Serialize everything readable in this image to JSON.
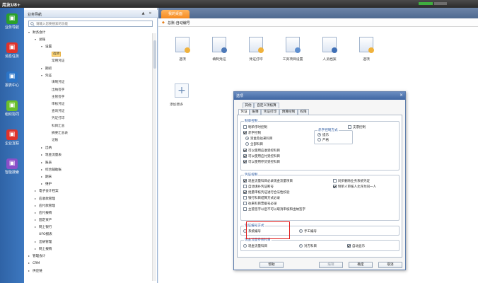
{
  "app": {
    "title": "用友U8+"
  },
  "rail": {
    "items": [
      {
        "label": "业务导航",
        "icon": "grid-icon",
        "color": "#2aa12a"
      },
      {
        "label": "消息任务",
        "icon": "message-icon",
        "color": "#e0332b"
      },
      {
        "label": "报表中心",
        "icon": "report-icon",
        "color": "#2b74c7"
      },
      {
        "label": "组织协同",
        "icon": "collaboration-icon",
        "color": "#6bbf2a"
      },
      {
        "label": "企业互联",
        "icon": "network-icon",
        "color": "#e0332b"
      },
      {
        "label": "智能搜索",
        "icon": "search-icon",
        "color": "#8a4fc9"
      }
    ]
  },
  "nav": {
    "title": "业务导航",
    "search_placeholder": "请输入您要搜索的功能",
    "tree": [
      {
        "label": "财务会计",
        "level": 0,
        "toggle": "▾"
      },
      {
        "label": "总账",
        "level": 1,
        "toggle": "▾"
      },
      {
        "label": "设置",
        "level": 2,
        "toggle": "▾"
      },
      {
        "label": "选项",
        "level": 3,
        "toggle": "",
        "selected": true
      },
      {
        "label": "常用凭证",
        "level": 3,
        "toggle": ""
      },
      {
        "label": "期初",
        "level": 2,
        "toggle": "▸"
      },
      {
        "label": "凭证",
        "level": 2,
        "toggle": "▾"
      },
      {
        "label": "填制凭证",
        "level": 3,
        "toggle": ""
      },
      {
        "label": "出纳签字",
        "level": 3,
        "toggle": ""
      },
      {
        "label": "主管签字",
        "level": 3,
        "toggle": ""
      },
      {
        "label": "审核凭证",
        "level": 3,
        "toggle": ""
      },
      {
        "label": "查询凭证",
        "level": 3,
        "toggle": ""
      },
      {
        "label": "凭证打印",
        "level": 3,
        "toggle": ""
      },
      {
        "label": "科目汇总",
        "level": 3,
        "toggle": ""
      },
      {
        "label": "摘要汇总表",
        "level": 3,
        "toggle": ""
      },
      {
        "label": "记账",
        "level": 3,
        "toggle": ""
      },
      {
        "label": "出纳",
        "level": 2,
        "toggle": "▸"
      },
      {
        "label": "现金流量表",
        "level": 2,
        "toggle": "▸"
      },
      {
        "label": "账表",
        "level": 2,
        "toggle": "▸"
      },
      {
        "label": "综合辅助账",
        "level": 2,
        "toggle": "▸"
      },
      {
        "label": "期末",
        "level": 2,
        "toggle": "▸"
      },
      {
        "label": "维护",
        "level": 2,
        "toggle": "▸"
      },
      {
        "label": "电子会计档案",
        "level": 1,
        "toggle": "▸"
      },
      {
        "label": "应收款管理",
        "level": 1,
        "toggle": "▸"
      },
      {
        "label": "应付款管理",
        "level": 1,
        "toggle": "▸"
      },
      {
        "label": "应付报销",
        "level": 1,
        "toggle": "▸"
      },
      {
        "label": "固定资产",
        "level": 1,
        "toggle": "▸"
      },
      {
        "label": "网上银行",
        "level": 1,
        "toggle": "▸"
      },
      {
        "label": "UFO报表",
        "level": 1,
        "toggle": ""
      },
      {
        "label": "出纳管理",
        "level": 1,
        "toggle": "▸"
      },
      {
        "label": "网上报销",
        "level": 1,
        "toggle": "▸"
      },
      {
        "label": "管理会计",
        "level": 0,
        "toggle": "▸"
      },
      {
        "label": "CRM",
        "level": 0,
        "toggle": "▸"
      },
      {
        "label": "供应链",
        "level": 0,
        "toggle": "▸"
      }
    ]
  },
  "main": {
    "tab_label": "我的桌面",
    "breadcrumb": "总账-自动编号",
    "apps": [
      {
        "label": "选项",
        "icon": "options-icon"
      },
      {
        "label": "填制凭证",
        "icon": "voucher-edit-icon"
      },
      {
        "label": "凭证打印",
        "icon": "voucher-print-icon"
      },
      {
        "label": "工资项目设置",
        "icon": "salary-items-icon"
      },
      {
        "label": "人员档案",
        "icon": "personnel-file-icon"
      },
      {
        "label": "选项",
        "icon": "options2-icon"
      }
    ],
    "add_more": "添加更多"
  },
  "dialog": {
    "title": "选项",
    "tabs_row1": [
      "其他",
      "自定义项核算"
    ],
    "tabs_row2": [
      "凭证",
      "账簿",
      "凭证打印",
      "预算控制",
      "权限"
    ],
    "active_tab": "凭证",
    "sec_control": {
      "title": "制单控制",
      "items": [
        {
          "label": "制单序时控制",
          "type": "checkbox",
          "checked": false
        },
        {
          "label": "支票控制",
          "type": "checkbox",
          "checked": false
        },
        {
          "label": "赤字控制",
          "type": "checkbox",
          "checked": true
        },
        {
          "label": "资金及往来科目",
          "type": "radio",
          "checked": true
        },
        {
          "label": "全部科目",
          "type": "radio",
          "checked": false
        },
        {
          "label": "可以使用应收受控科目",
          "type": "checkbox",
          "checked": true
        },
        {
          "label": "可以使用应付受控科目",
          "type": "checkbox",
          "checked": true
        },
        {
          "label": "可以使用存货受控科目",
          "type": "checkbox",
          "checked": true
        }
      ],
      "deficit_mode_title": "赤字控制方式",
      "deficit_modes": [
        {
          "label": "提示",
          "checked": true
        },
        {
          "label": "严格",
          "checked": false
        }
      ]
    },
    "sec_voucher": {
      "title": "凭证控制",
      "items": [
        {
          "label": "现金流量科目必录现金流量项目",
          "checked": true
        },
        {
          "label": "同步删除业务系统凭证",
          "checked": false
        },
        {
          "label": "自动填补凭证断号",
          "checked": false
        },
        {
          "label": "制单人审核人允许为同一人",
          "checked": true
        },
        {
          "label": "批量审核凭证进行合法性校验",
          "checked": true
        },
        {
          "label": "银行科目结算方式必录",
          "checked": false
        },
        {
          "label": "往来科目票据号必录",
          "checked": false
        },
        {
          "label": "主管签字以后不可以取消审核和出纳签字",
          "checked": false
        }
      ]
    },
    "sec_numbering": {
      "title": "凭证编号方式",
      "options": [
        {
          "label": "系统编号",
          "checked": false
        },
        {
          "label": "手工编号",
          "checked": true
        }
      ]
    },
    "sec_cashflow": {
      "title": "现金流量参照科目",
      "options": [
        {
          "label": "现金流量科目",
          "type": "radio",
          "checked": false
        },
        {
          "label": "对方科目",
          "type": "radio",
          "checked": true
        },
        {
          "label": "自动显示",
          "type": "checkbox",
          "checked": true
        }
      ]
    },
    "buttons": {
      "help": "帮助",
      "edit": "编辑",
      "ok": "确定",
      "cancel": "取消"
    },
    "highlight_color": "#e01c1c"
  }
}
